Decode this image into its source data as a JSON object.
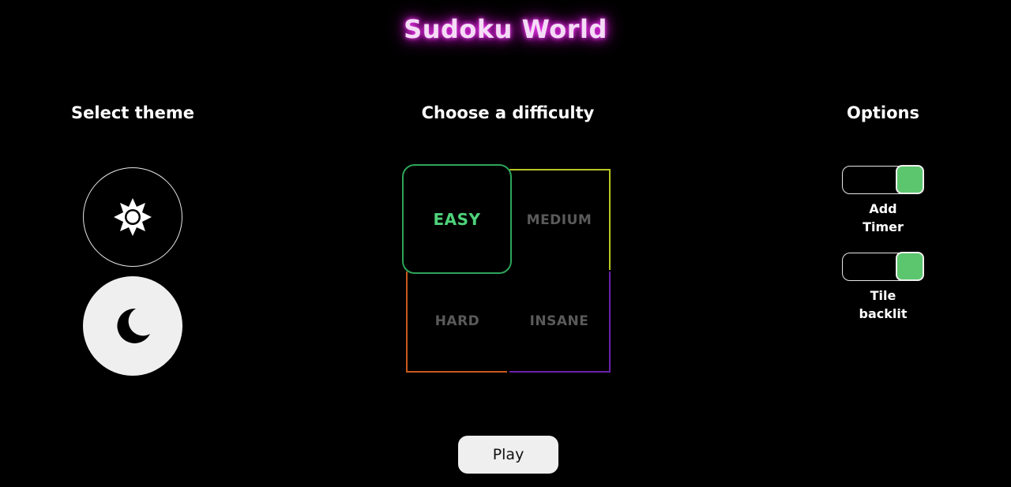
{
  "app": {
    "title": "Sudoku World"
  },
  "theme": {
    "heading": "Select theme",
    "options": [
      {
        "icon": "sun-icon",
        "selected": false
      },
      {
        "icon": "moon-icon",
        "selected": true
      }
    ]
  },
  "difficulty": {
    "heading": "Choose a difficulty",
    "levels": [
      {
        "label": "EASY",
        "color": "#2ea45a",
        "selected": true
      },
      {
        "label": "MEDIUM",
        "color": "#b8c423",
        "selected": false
      },
      {
        "label": "HARD",
        "color": "#c85a1d",
        "selected": false
      },
      {
        "label": "INSANE",
        "color": "#6a22a8",
        "selected": false
      }
    ]
  },
  "options": {
    "heading": "Options",
    "toggles": [
      {
        "line1": "Add",
        "line2": "Timer",
        "on": true
      },
      {
        "line1": "Tile",
        "line2": "backlit",
        "on": true
      }
    ],
    "toggle_on_color": "#5cc66e"
  },
  "actions": {
    "play_label": "Play"
  },
  "colors": {
    "title_glow": "#e020e0",
    "background": "#000000"
  }
}
